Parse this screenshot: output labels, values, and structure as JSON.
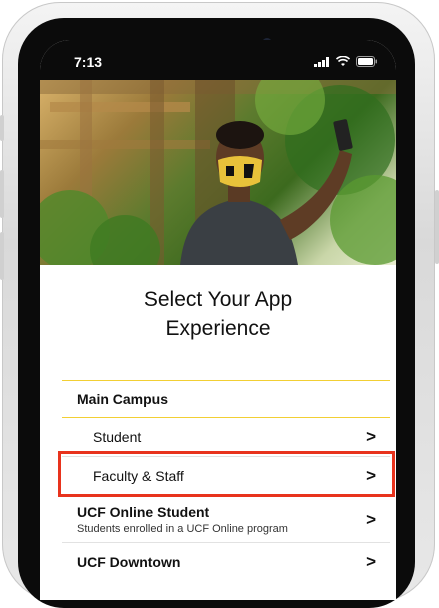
{
  "status_bar": {
    "time": "7:13"
  },
  "hero": {
    "icon": "man-in-face-mask-taking-selfie"
  },
  "page": {
    "title_line1": "Select Your App",
    "title_line2": "Experience"
  },
  "menu": {
    "main_campus": {
      "label": "Main Campus",
      "student": "Student",
      "faculty_staff": "Faculty & Staff"
    },
    "ucf_online": {
      "label": "UCF Online Student",
      "description": "Students enrolled in a UCF Online program"
    },
    "ucf_downtown": {
      "label": "UCF Downtown"
    },
    "chevron": ">"
  },
  "colors": {
    "accent_yellow": "#f2cf34",
    "highlight_red": "#e8331d"
  }
}
